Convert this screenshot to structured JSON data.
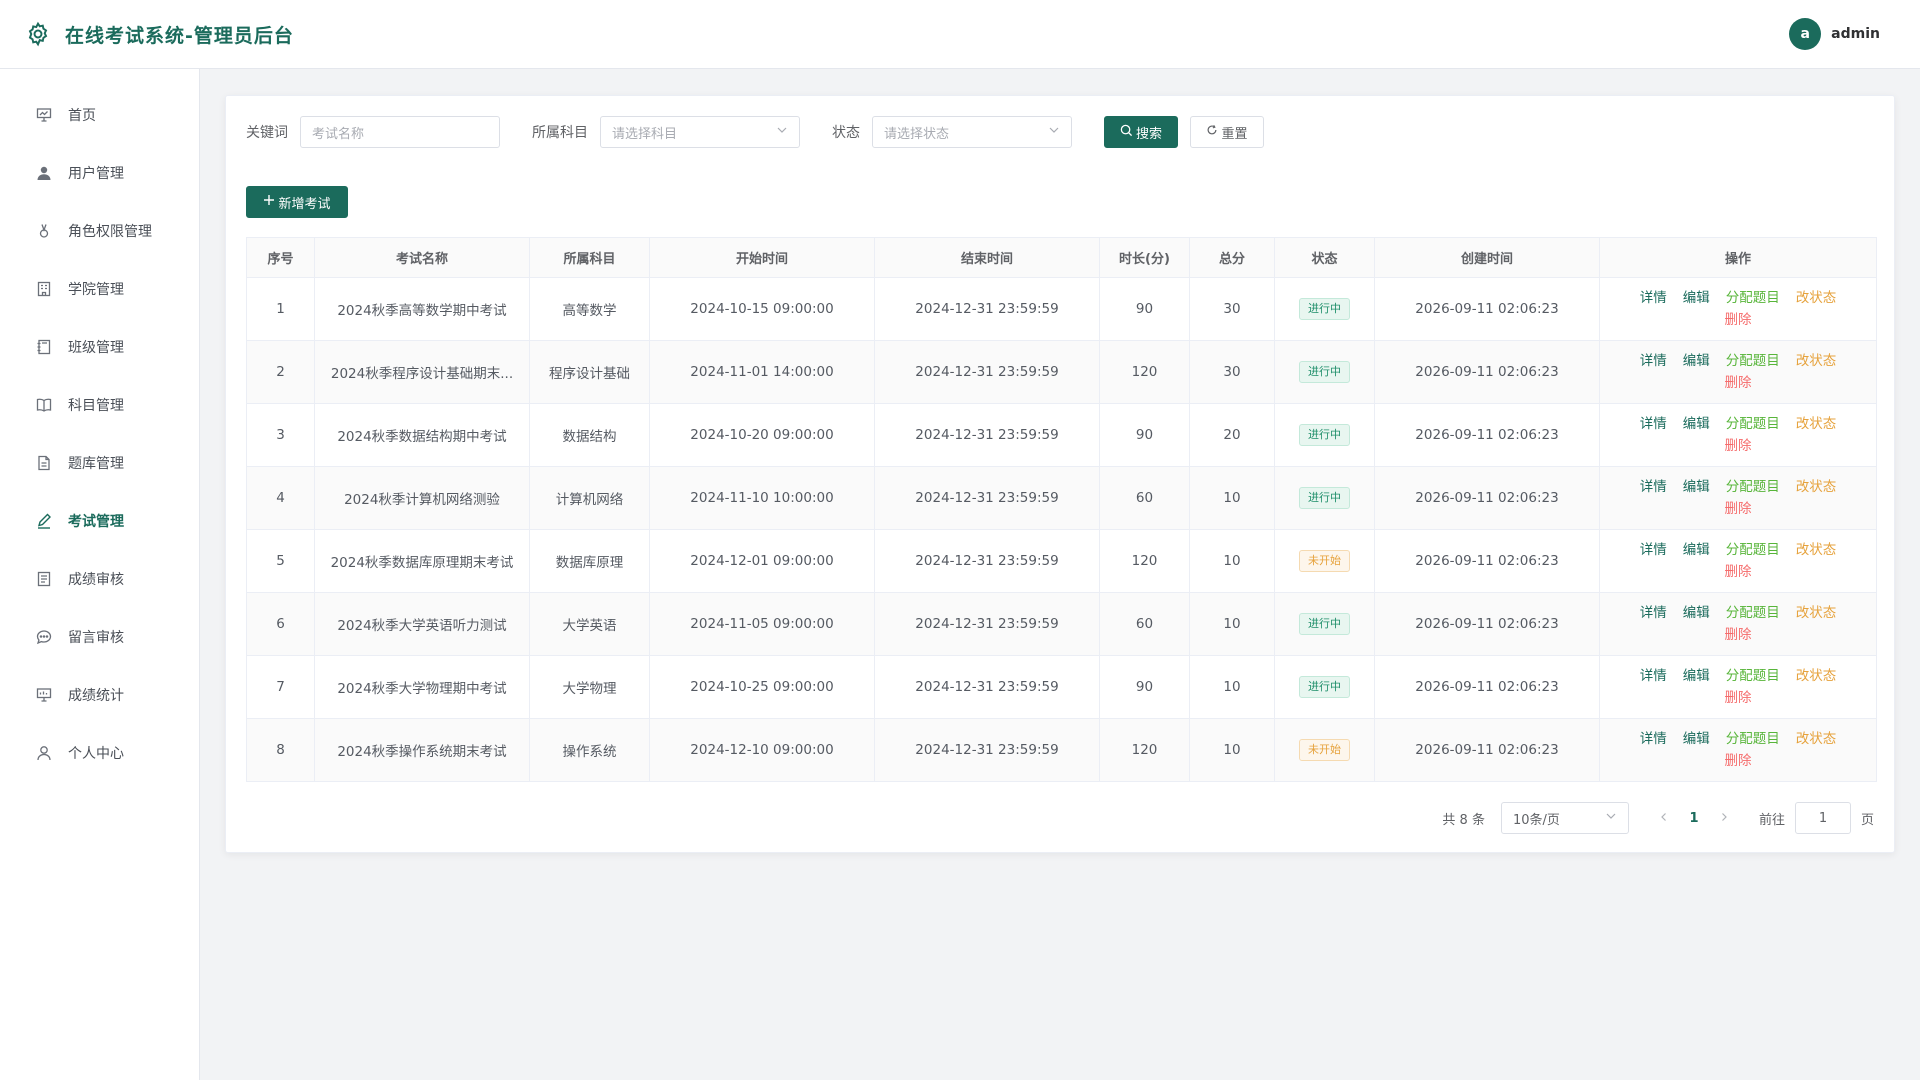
{
  "header": {
    "title": "在线考试系统-管理员后台",
    "avatar_letter": "a",
    "username": "admin"
  },
  "sidebar": {
    "items": [
      {
        "label": "首页",
        "icon": "presentation-icon"
      },
      {
        "label": "用户管理",
        "icon": "user-filled-icon"
      },
      {
        "label": "角色权限管理",
        "icon": "medal-icon"
      },
      {
        "label": "学院管理",
        "icon": "office-building-icon"
      },
      {
        "label": "班级管理",
        "icon": "notebook-icon"
      },
      {
        "label": "科目管理",
        "icon": "book-open-icon"
      },
      {
        "label": "题库管理",
        "icon": "document-icon"
      },
      {
        "label": "考试管理",
        "icon": "edit-pen-icon",
        "active": true
      },
      {
        "label": "成绩审核",
        "icon": "list-icon"
      },
      {
        "label": "留言审核",
        "icon": "chat-dot-icon"
      },
      {
        "label": "成绩统计",
        "icon": "data-board-icon"
      },
      {
        "label": "个人中心",
        "icon": "user-icon"
      }
    ]
  },
  "filters": {
    "keyword_label": "关键词",
    "keyword_placeholder": "考试名称",
    "subject_label": "所属科目",
    "subject_placeholder": "请选择科目",
    "status_label": "状态",
    "status_placeholder": "请选择状态",
    "search_label": "搜索",
    "reset_label": "重置"
  },
  "add_button": "新增考试",
  "table": {
    "columns": [
      "序号",
      "考试名称",
      "所属科目",
      "开始时间",
      "结束时间",
      "时长(分)",
      "总分",
      "状态",
      "创建时间",
      "操作"
    ],
    "rows": [
      {
        "no": "1",
        "name": "2024秋季高等数学期中考试",
        "subject": "高等数学",
        "start": "2024-10-15 09:00:00",
        "end": "2024-12-31 23:59:59",
        "duration": "90",
        "score": "30",
        "status": "进行中",
        "created": "2026-09-11 02:06:23"
      },
      {
        "no": "2",
        "name": "2024秋季程序设计基础期末...",
        "subject": "程序设计基础",
        "start": "2024-11-01 14:00:00",
        "end": "2024-12-31 23:59:59",
        "duration": "120",
        "score": "30",
        "status": "进行中",
        "created": "2026-09-11 02:06:23"
      },
      {
        "no": "3",
        "name": "2024秋季数据结构期中考试",
        "subject": "数据结构",
        "start": "2024-10-20 09:00:00",
        "end": "2024-12-31 23:59:59",
        "duration": "90",
        "score": "20",
        "status": "进行中",
        "created": "2026-09-11 02:06:23"
      },
      {
        "no": "4",
        "name": "2024秋季计算机网络测验",
        "subject": "计算机网络",
        "start": "2024-11-10 10:00:00",
        "end": "2024-12-31 23:59:59",
        "duration": "60",
        "score": "10",
        "status": "进行中",
        "created": "2026-09-11 02:06:23"
      },
      {
        "no": "5",
        "name": "2024秋季数据库原理期末考试",
        "subject": "数据库原理",
        "start": "2024-12-01 09:00:00",
        "end": "2024-12-31 23:59:59",
        "duration": "120",
        "score": "10",
        "status": "未开始",
        "created": "2026-09-11 02:06:23"
      },
      {
        "no": "6",
        "name": "2024秋季大学英语听力测试",
        "subject": "大学英语",
        "start": "2024-11-05 09:00:00",
        "end": "2024-12-31 23:59:59",
        "duration": "60",
        "score": "10",
        "status": "进行中",
        "created": "2026-09-11 02:06:23"
      },
      {
        "no": "7",
        "name": "2024秋季大学物理期中考试",
        "subject": "大学物理",
        "start": "2024-10-25 09:00:00",
        "end": "2024-12-31 23:59:59",
        "duration": "90",
        "score": "10",
        "status": "进行中",
        "created": "2026-09-11 02:06:23"
      },
      {
        "no": "8",
        "name": "2024秋季操作系统期末考试",
        "subject": "操作系统",
        "start": "2024-12-10 09:00:00",
        "end": "2024-12-31 23:59:59",
        "duration": "120",
        "score": "10",
        "status": "未开始",
        "created": "2026-09-11 02:06:23"
      }
    ],
    "actions": {
      "detail": "详情",
      "edit": "编辑",
      "assign": "分配题目",
      "status": "改状态",
      "delete": "删除"
    }
  },
  "pagination": {
    "total_text": "共 8 条",
    "page_size": "10条/页",
    "current_page": "1",
    "goto_label": "前往",
    "goto_value": "1",
    "page_suffix": "页"
  },
  "colors": {
    "primary": "#1b6b5c",
    "in_progress": "#1f8f6a",
    "not_started": "#e6a23c",
    "assign": "#58b53a",
    "delete": "#f56c6c"
  }
}
